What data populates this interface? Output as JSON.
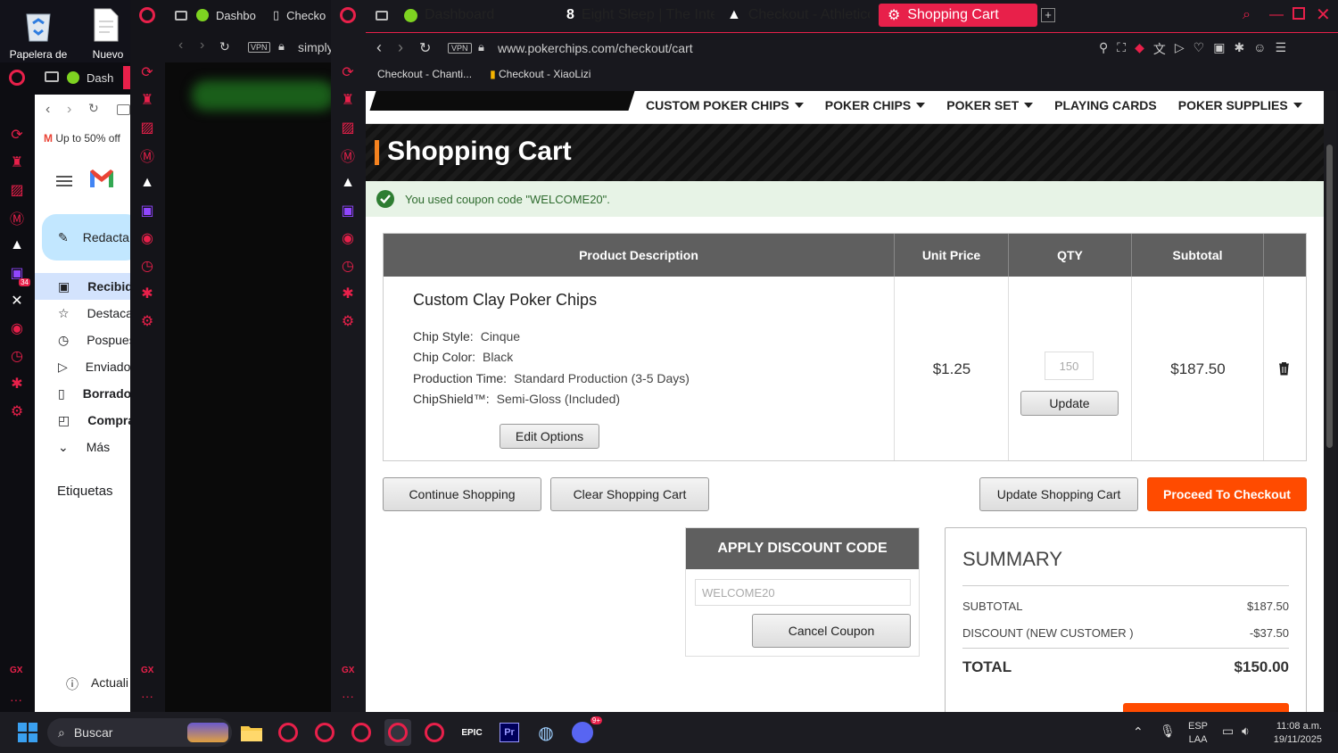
{
  "desktop": {
    "recycle_label": "Papelera de",
    "new_label": "Nuevo"
  },
  "win1": {
    "tab_label": "Dash",
    "ad_text": "Up to 50% off",
    "compose": "Redacta",
    "nav": [
      "Recibid",
      "Destaca",
      "Pospues",
      "Enviado",
      "Borrado",
      "Compra",
      "Más"
    ],
    "labels": "Etiquetas",
    "update": "Actuali",
    "gx": "GX",
    "twitch_badge": "34"
  },
  "win2": {
    "tabs": [
      "Dashbo",
      "Checko"
    ],
    "vpn": "VPN",
    "url": "simply",
    "gx": "GX"
  },
  "win3": {
    "tabs": [
      {
        "label": "Dashboard"
      },
      {
        "label": "Eight Sleep | The Intellige"
      },
      {
        "label": "Checkout - Athletico"
      },
      {
        "label": "Shopping Cart",
        "active": true
      }
    ],
    "vpn": "VPN",
    "url": "www.pokerchips.com/checkout/cart",
    "bookmarks": [
      "Checkout - Chanti...",
      "Checkout - XiaoLizi"
    ],
    "gx": "GX"
  },
  "site": {
    "menu": [
      "CUSTOM POKER CHIPS",
      "POKER CHIPS",
      "POKER SET",
      "PLAYING CARDS",
      "POKER SUPPLIES"
    ],
    "menu_caret": [
      true,
      true,
      true,
      false,
      true
    ],
    "title": "Shopping Cart",
    "notice": "You used coupon code \"WELCOME20\".",
    "table": {
      "headers": [
        "Product Description",
        "Unit Price",
        "QTY",
        "Subtotal"
      ],
      "product": "Custom Clay Poker Chips",
      "options": [
        {
          "k": "Chip Style:",
          "v": "Cinque"
        },
        {
          "k": "Chip Color:",
          "v": "Black"
        },
        {
          "k": "Production Time:",
          "v": "Standard Production (3-5 Days)"
        },
        {
          "k": "ChipShield™:",
          "v": "Semi-Gloss (Included)"
        }
      ],
      "edit": "Edit Options",
      "unit_price": "$1.25",
      "qty": "150",
      "update": "Update",
      "subtotal": "$187.50"
    },
    "buttons": {
      "continue": "Continue Shopping",
      "clear": "Clear Shopping Cart",
      "update_cart": "Update Shopping Cart",
      "checkout": "Proceed To Checkout"
    },
    "discount": {
      "title": "APPLY DISCOUNT CODE",
      "code": "WELCOME20",
      "cancel": "Cancel Coupon"
    },
    "summary": {
      "title": "SUMMARY",
      "subtotal_label": "SUBTOTAL",
      "subtotal": "$187.50",
      "discount_label": "DISCOUNT (NEW CUSTOMER )",
      "discount": "-$37.50",
      "total_label": "TOTAL",
      "total": "$150.00"
    },
    "colors": {
      "accent": "#f5821f",
      "checkout": "#ff4b00",
      "opera": "#e8204a"
    }
  },
  "taskbar": {
    "search": "Buscar",
    "lang": "ESP",
    "layout": "LAA",
    "time": "11:08 a.m.",
    "date": "19/11/2025",
    "discord_badge": "9+"
  }
}
